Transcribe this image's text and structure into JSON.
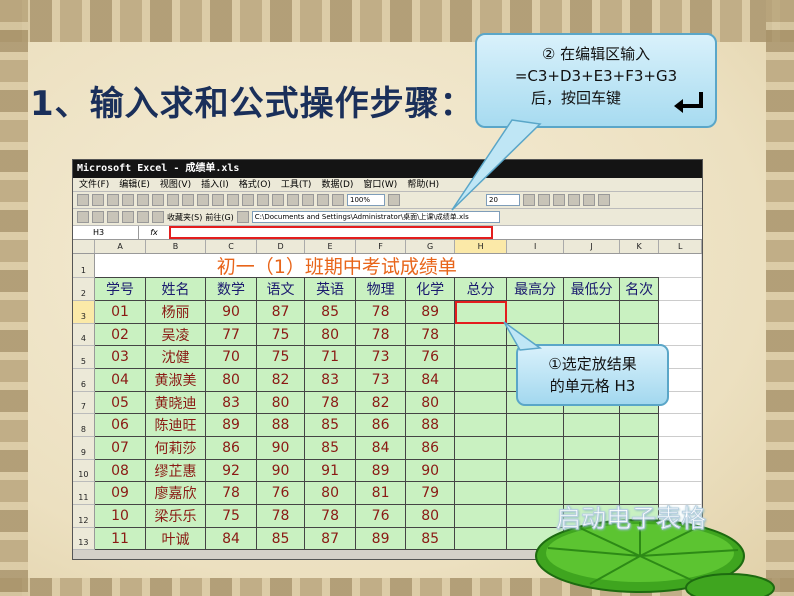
{
  "slide": {
    "title": "1、输入求和公式操作步骤：",
    "callout_step2": {
      "line1": "② 在编辑区输入",
      "line2": "=C3+D3+E3+F3+G3",
      "line3": "后，按回车键"
    },
    "callout_step1": {
      "line1": "①选定放结果",
      "line2": "的单元格 H3"
    },
    "lotus_caption": "启动电子表格"
  },
  "excel": {
    "window_title": "Microsoft Excel - 成绩单.xls",
    "menu": [
      "文件(F)",
      "编辑(E)",
      "视图(V)",
      "插入(I)",
      "格式(O)",
      "工具(T)",
      "数据(D)",
      "窗口(W)",
      "帮助(H)"
    ],
    "toolbar": {
      "zoom": "100%",
      "font_size": "20",
      "favorites_label": "收藏夹(S)",
      "goto_label": "前往(G)",
      "path": "C:\\Documents and Settings\\Administrator\\桌面\\上课\\成绩单.xls"
    },
    "name_box": "H3",
    "fx_label": "fx",
    "column_headers": [
      "A",
      "B",
      "C",
      "D",
      "E",
      "F",
      "G",
      "H",
      "I",
      "J",
      "K",
      "L"
    ],
    "row_numbers": [
      "1",
      "2",
      "3",
      "4",
      "5",
      "6",
      "7",
      "8",
      "9",
      "10",
      "11",
      "12",
      "13"
    ],
    "sheet_title": "初一（1）班期中考试成绩单",
    "table_headers": [
      "学号",
      "姓名",
      "数学",
      "语文",
      "英语",
      "物理",
      "化学",
      "总分",
      "最高分",
      "最低分",
      "名次"
    ],
    "rows": [
      [
        "01",
        "杨丽",
        "90",
        "87",
        "85",
        "78",
        "89"
      ],
      [
        "02",
        "吴凌",
        "77",
        "75",
        "80",
        "78",
        "78"
      ],
      [
        "03",
        "沈健",
        "70",
        "75",
        "71",
        "73",
        "76"
      ],
      [
        "04",
        "黄淑美",
        "80",
        "82",
        "83",
        "73",
        "84"
      ],
      [
        "05",
        "黄晓迪",
        "83",
        "80",
        "78",
        "82",
        "80"
      ],
      [
        "06",
        "陈迪旺",
        "89",
        "88",
        "85",
        "86",
        "88"
      ],
      [
        "07",
        "何莉莎",
        "86",
        "90",
        "85",
        "84",
        "86"
      ],
      [
        "08",
        "缪芷惠",
        "92",
        "90",
        "91",
        "89",
        "90"
      ],
      [
        "09",
        "廖嘉欣",
        "78",
        "76",
        "80",
        "81",
        "79"
      ],
      [
        "10",
        "梁乐乐",
        "75",
        "78",
        "78",
        "76",
        "80"
      ],
      [
        "11",
        "叶诚",
        "84",
        "85",
        "87",
        "89",
        "85"
      ]
    ],
    "selected_cell": "H3"
  }
}
